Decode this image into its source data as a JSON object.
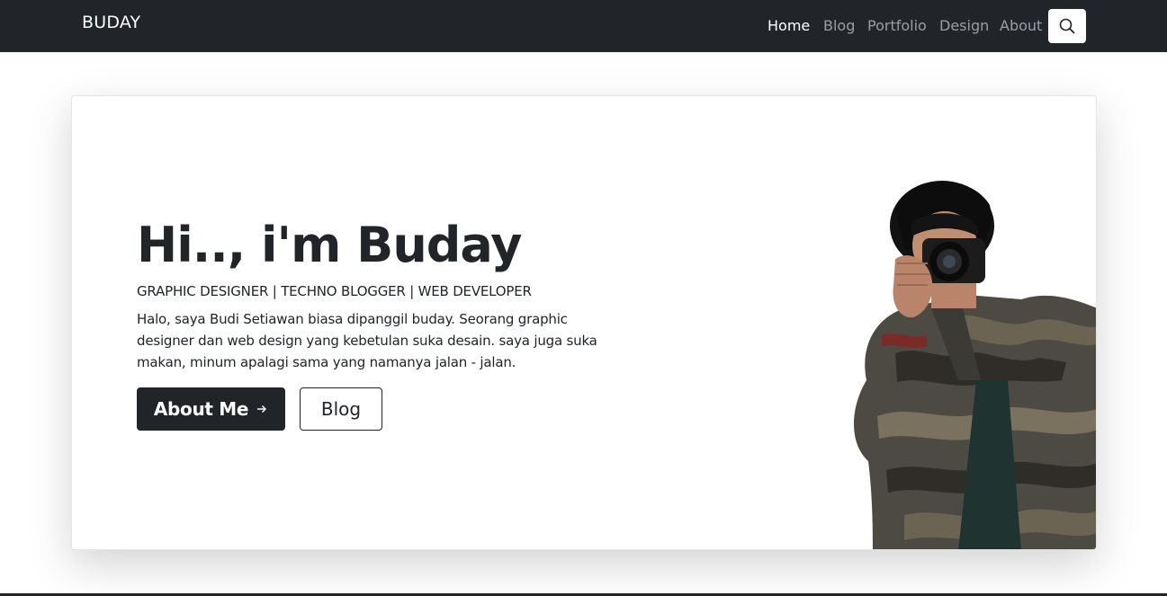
{
  "navbar": {
    "brand": "BUDAY",
    "links": [
      {
        "label": "Home",
        "active": true
      },
      {
        "label": "Blog",
        "active": false
      },
      {
        "label": "Portfolio",
        "active": false
      },
      {
        "label": "Design",
        "active": false
      },
      {
        "label": "About",
        "active": false
      }
    ],
    "search_icon": "search-icon"
  },
  "hero": {
    "title": "Hi.., i'm Buday",
    "subtitle": "GRAPHIC DESIGNER | TECHNO BLOGGER | WEB DEVELOPER",
    "description": "Halo, saya Budi Setiawan biasa dipanggil buday. Seorang graphic designer dan web design yang kebetulan suka desain. saya juga suka makan, minum apalagi sama yang namanya jalan - jalan.",
    "primary_button": {
      "label": "About Me",
      "icon": "arrow-right-icon"
    },
    "secondary_button": {
      "label": "Blog"
    }
  },
  "colors": {
    "navbar_bg": "#212529",
    "text_dark": "#212529",
    "white": "#ffffff"
  }
}
